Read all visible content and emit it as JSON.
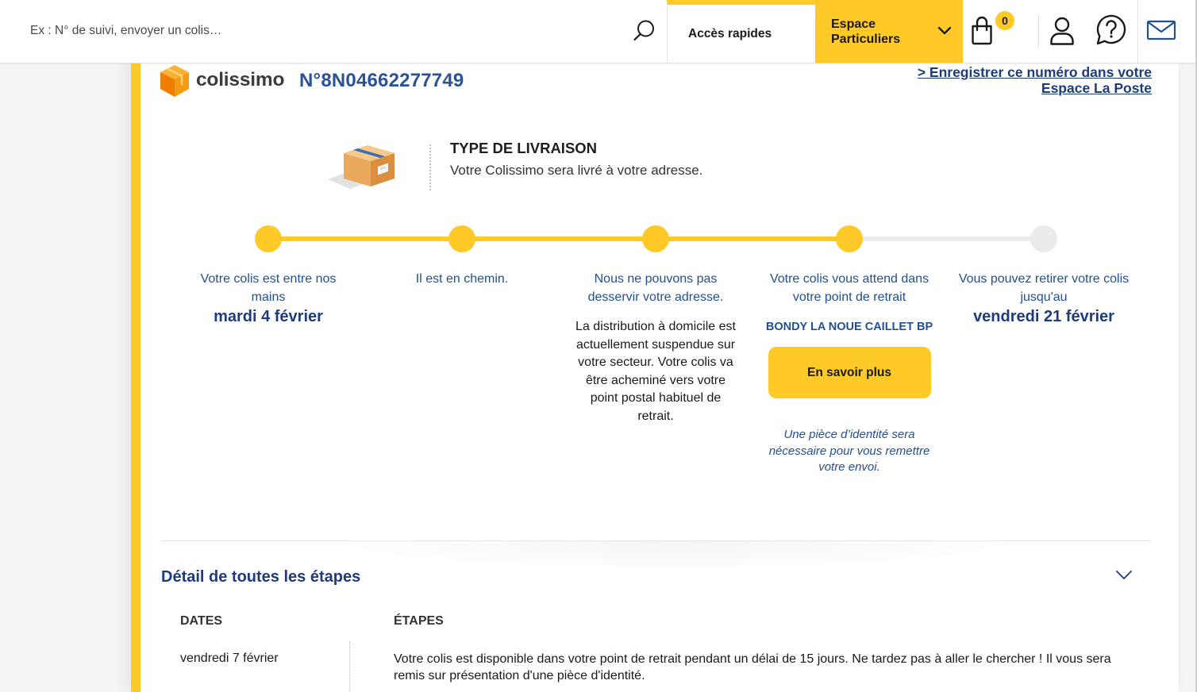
{
  "header": {
    "search_placeholder": "Ex : N° de suivi, envoyer un colis…",
    "quick_access_label": "Accès rapides",
    "space_label": "Espace Particuliers",
    "cart_count": "0"
  },
  "icons": {
    "search": "search-icon",
    "dropdown": "chevron-down-icon",
    "cart": "shopping-bag-icon",
    "account": "user-icon",
    "help": "help-bubble-icon",
    "mail": "mail-icon",
    "brand": "colissimo-cube-icon",
    "delivery": "parcel-box-icon",
    "expand": "chevron-down-icon"
  },
  "tracking": {
    "brand_name": "colissimo",
    "number": "N°8N04662277749",
    "save_link": "> Enregistrer ce numéro dans votre Espace La Poste"
  },
  "delivery_type": {
    "title": "TYPE DE LIVRAISON",
    "description": "Votre Colissimo sera livré à votre adresse."
  },
  "timeline": {
    "steps": [
      {
        "label": "Votre colis est entre nos mains",
        "date": "mardi 4 février",
        "reached": true
      },
      {
        "label": "Il est en chemin.",
        "reached": true
      },
      {
        "label": "Nous ne pouvons pas desservir votre adresse.",
        "detail": "La distribution à domicile est actuellement suspendue sur votre secteur. Votre colis va être acheminé vers votre point postal habituel de retrait.",
        "reached": true
      },
      {
        "label": "Votre colis vous attend dans votre point de retrait",
        "location": "BONDY LA NOUE CAILLET BP",
        "button_label": "En savoir plus",
        "note": "Une pièce d’identité sera nécessaire pour vous remettre votre envoi.",
        "reached": true
      },
      {
        "label": "Vous pouvez retirer votre colis jusqu'au",
        "date": "vendredi 21 février",
        "reached": false
      }
    ]
  },
  "details": {
    "title": "Détail de toutes les étapes",
    "columns": [
      "DATES",
      "ÉTAPES"
    ],
    "rows": [
      {
        "date": "vendredi 7 février",
        "text": "Votre colis est disponible dans votre point de retrait pendant un délai de 15 jours. Ne tardez pas à aller le chercher ! Il vous sera remis sur présentation d'une pièce d'identité."
      }
    ]
  },
  "colors": {
    "accent": "#ffc928",
    "primary_blue": "#24508f",
    "dark_blue": "#1e3c78",
    "inactive": "#ebebeb"
  }
}
